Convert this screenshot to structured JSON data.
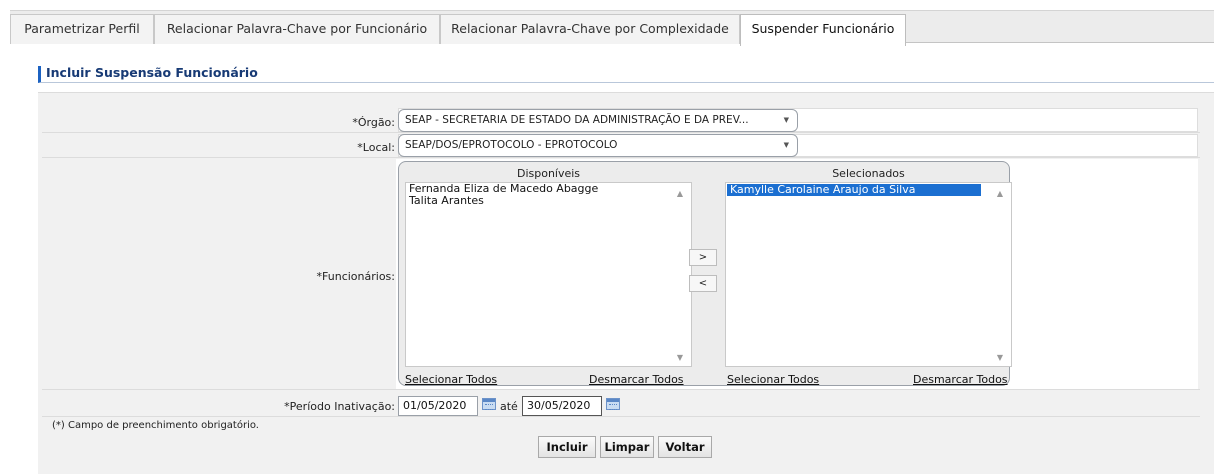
{
  "tabs": [
    {
      "label": "Parametrizar Perfil",
      "active": false
    },
    {
      "label": "Relacionar Palavra-Chave por Funcionário",
      "active": false
    },
    {
      "label": "Relacionar Palavra-Chave por Complexidade",
      "active": false
    },
    {
      "label": "Suspender Funcionário",
      "active": true
    }
  ],
  "section_title": "Incluir Suspensão Funcionário",
  "form": {
    "orgao": {
      "label": "*Órgão:",
      "value": "SEAP - SECRETARIA DE ESTADO DA ADMINISTRAÇÃO E DA PREV..."
    },
    "local": {
      "label": "*Local:",
      "value": "SEAP/DOS/EPROTOCOLO - EPROTOCOLO"
    },
    "funcionarios": {
      "label": "*Funcionários:",
      "disponiveis_title": "Disponíveis",
      "selecionados_title": "Selecionados",
      "disponiveis": [
        "Fernanda Eliza de Macedo Abagge",
        "Talita Arantes"
      ],
      "selecionados": [
        "Kamylle Carolaine Araujo da Silva"
      ],
      "move_right": ">",
      "move_left": "<",
      "select_all": "Selecionar Todos",
      "deselect_all": "Desmarcar Todos"
    },
    "periodo": {
      "label": "*Período Inativação:",
      "start": "01/05/2020",
      "separator": "até",
      "end": "30/05/2020"
    },
    "required_note": "(*) Campo de preenchimento obrigatório."
  },
  "buttons": {
    "incluir": "Incluir",
    "limpar": "Limpar",
    "voltar": "Voltar"
  },
  "icons": {
    "calendar": "calendar-icon",
    "dropdown": "chevron-down-icon",
    "scroll_up": "scroll-up-arrow-icon",
    "scroll_down": "scroll-down-arrow-icon"
  },
  "colors": {
    "accent": "#1c62c2",
    "selected_row": "#1b6fd1",
    "panel_bg": "#f1f1f1"
  }
}
